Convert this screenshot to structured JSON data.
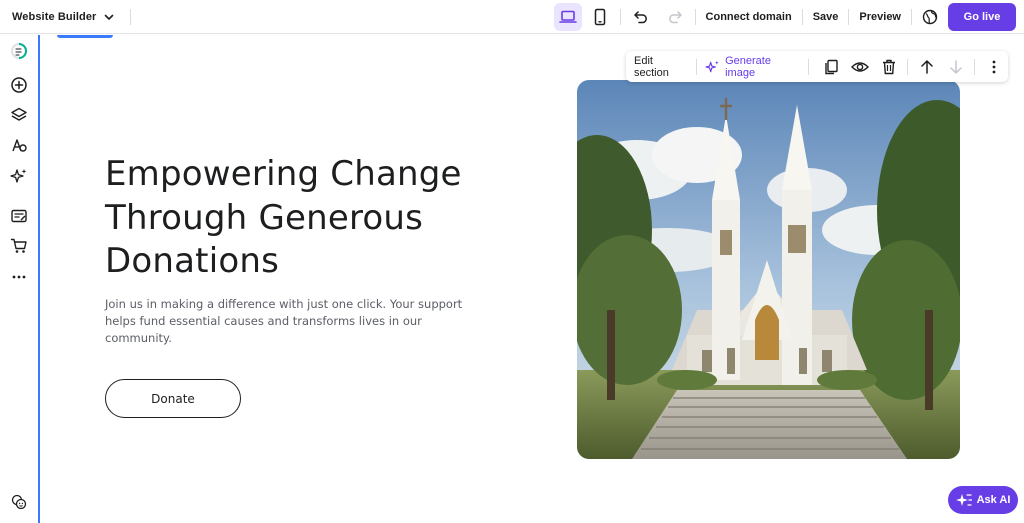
{
  "topbar": {
    "app_title": "Website Builder",
    "connect_domain": "Connect domain",
    "save": "Save",
    "preview": "Preview",
    "go_live": "Go live"
  },
  "hero": {
    "title": "Empowering Change Through Generous Donations",
    "subtitle": "Join us in making a difference with just one click. Your support helps fund essential causes and transforms lives in our community.",
    "button": "Donate"
  },
  "section_toolbar": {
    "edit_section": "Edit section",
    "generate_image": "Generate image"
  },
  "ask_ai": "Ask AI",
  "colors": {
    "accent": "#673de6",
    "accent_light": "#ebe4ff",
    "selection_blue": "#3a7bfd"
  },
  "icons": [
    "desktop-icon",
    "mobile-icon",
    "undo-icon",
    "redo-icon",
    "globe-icon",
    "chevron-down-icon",
    "sparkle-icon",
    "duplicate-icon",
    "eye-icon",
    "trash-icon",
    "arrow-up-icon",
    "arrow-down-icon",
    "more-vertical-icon",
    "add-icon",
    "layers-icon",
    "design-icon",
    "ai-tools-icon",
    "blog-icon",
    "store-icon",
    "more-horizontal-icon",
    "help-icon"
  ]
}
